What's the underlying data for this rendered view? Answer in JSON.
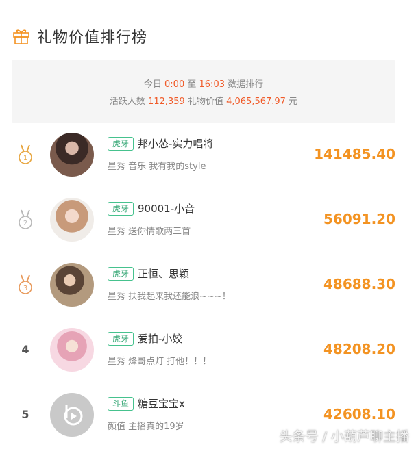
{
  "header": {
    "title": "礼物价值排行榜",
    "icon": "gift-icon"
  },
  "summary": {
    "today_label": "今日",
    "start_time": "0:00",
    "to_label": "至",
    "end_time": "16:03",
    "ranking_label": "数据排行",
    "active_label": "活跃人数",
    "active_count": "112,359",
    "gift_label": "礼物价值",
    "gift_total": "4,065,567.97",
    "unit": "元"
  },
  "colors": {
    "accent_orange": "#f39322",
    "highlight_red": "#f05a28",
    "platform_green": "#46c28e"
  },
  "rankings": [
    {
      "rank": "1",
      "platform": "虎牙",
      "name": "邦小怂-实力唱将",
      "desc": "星秀 音乐 我有我的style",
      "value": "141485.40"
    },
    {
      "rank": "2",
      "platform": "虎牙",
      "name": "90001-小音",
      "desc": "星秀 送你情歌两三首",
      "value": "56091.20"
    },
    {
      "rank": "3",
      "platform": "虎牙",
      "name": "正恒、思颖",
      "desc": "星秀 扶我起来我还能浪~~~！",
      "value": "48688.30"
    },
    {
      "rank": "4",
      "platform": "虎牙",
      "name": "爱拍-小姣",
      "desc": "星秀 烽哥点灯 打他！！！",
      "value": "48208.20"
    },
    {
      "rank": "5",
      "platform": "斗鱼",
      "name": "糖豆宝宝x",
      "desc": "颜值 主播真的19岁",
      "value": "42608.10"
    }
  ],
  "watermark": "头条号 / 小葫芦聊主播"
}
